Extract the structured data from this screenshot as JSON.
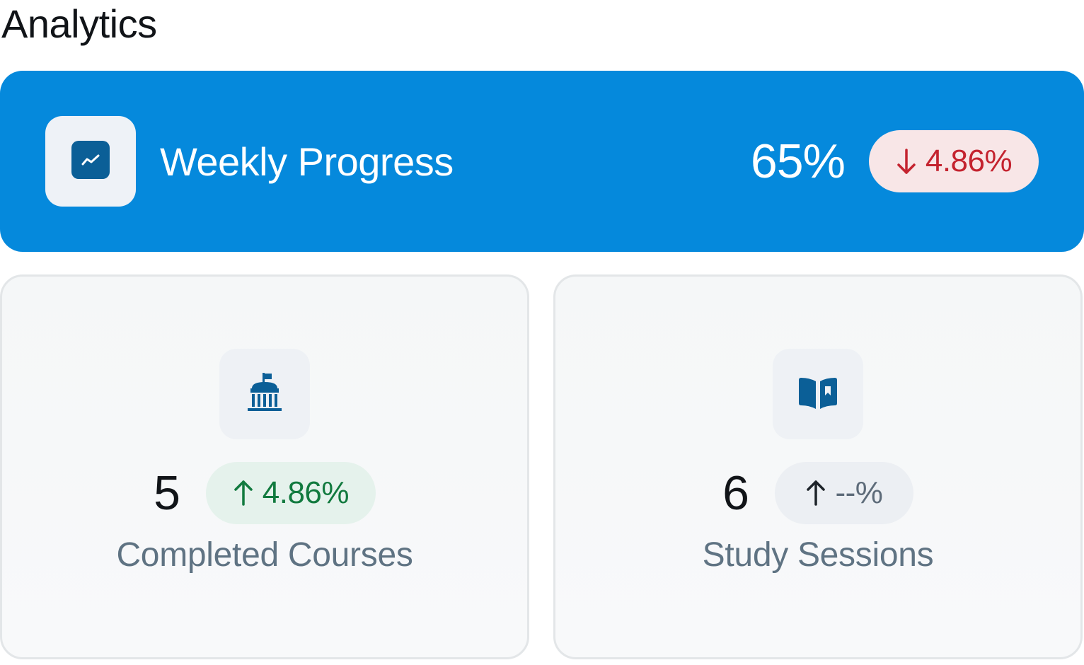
{
  "page": {
    "title": "Analytics"
  },
  "weekly_progress": {
    "title": "Weekly Progress",
    "value": "65%",
    "change": "4.86%",
    "change_direction": "down",
    "icon": "trend-line-icon",
    "colors": {
      "card_background": "#0589dc",
      "badge_background": "#f8e6e7",
      "badge_text": "#c4232f"
    }
  },
  "stats": [
    {
      "label": "Completed Courses",
      "value": "5",
      "change": "4.86%",
      "change_direction": "up",
      "icon": "institution-flag-icon",
      "colors": {
        "badge_background": "#e5f2ec",
        "badge_text": "#127a3f"
      }
    },
    {
      "label": "Study Sessions",
      "value": "6",
      "change": "--%",
      "change_direction": "up",
      "icon": "open-book-bookmark-icon",
      "colors": {
        "badge_background": "#eceff3",
        "badge_text": "#5d6b79"
      }
    }
  ]
}
